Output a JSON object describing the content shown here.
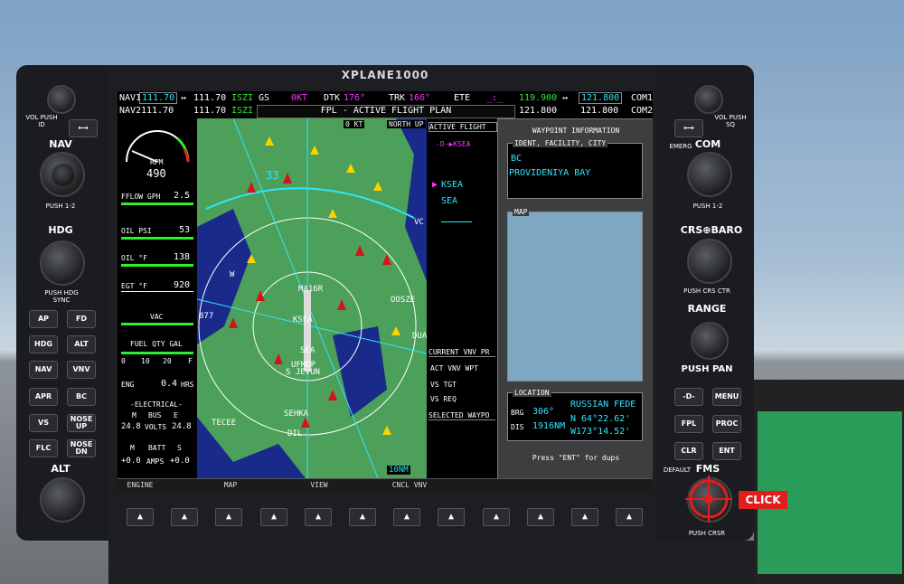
{
  "title": "XPLANE1000",
  "nav1": {
    "label": "NAV1",
    "active": "111.70",
    "standby": "111.70",
    "ident": "ISZI"
  },
  "nav2": {
    "label": "NAV2",
    "active": "111.70",
    "standby": "111.70",
    "ident": "ISZI"
  },
  "top": {
    "gs_label": "GS",
    "gs_val": "0KT",
    "dtk_label": "DTK",
    "dtk_val": "176°",
    "trk_label": "TRK",
    "trk_val": "166°",
    "ete_label": "ETE",
    "ete_val": "_:_",
    "fpl_banner": "FPL - ACTIVE FLIGHT PLAN"
  },
  "com1": {
    "label": "COM1",
    "active": "119.900",
    "standby": "121.800"
  },
  "com2": {
    "label": "COM2",
    "active": "121.800",
    "standby": "121.800"
  },
  "eis": {
    "rpm_label": "RPM",
    "rpm_val": "490",
    "fflow_label": "FFLOW GPH",
    "fflow_val": "2.5",
    "oilpsi_label": "OIL PSI",
    "oilpsi_val": "53",
    "oilf_label": "OIL °F",
    "oilf_val": "138",
    "egt_label": "EGT °F",
    "egt_val": "920",
    "vac_label": "VAC",
    "fuel_label": "FUEL QTY GAL",
    "fuel_ticks": [
      "0",
      "10",
      "20"
    ],
    "fuel_f": "F",
    "eng_label": "ENG",
    "eng_val": "0.4",
    "eng_unit": "HRS",
    "elec_label": "-ELECTRICAL-",
    "bus_m": "M",
    "bus_label": "BUS",
    "bus_e": "E",
    "volts_m": "24.8",
    "volts_unit": "VOLTS",
    "volts_e": "24.8",
    "batt_m": "M",
    "batt_label": "BATT",
    "batt_s": "S",
    "amps_m": "+0.0",
    "amps_unit": "AMPS",
    "amps_s": "+0.0"
  },
  "map": {
    "speed": "0 KT",
    "orient": "NORTH UP",
    "range": "10NM",
    "labels": [
      "MA16R",
      "KSEA",
      "SEA",
      "UFMDP",
      "S JEVUN",
      "TECEE",
      "OOSZE",
      "877",
      "DUA",
      "W",
      "VC",
      "33",
      "SEHKA",
      "DIL"
    ]
  },
  "fpl": {
    "header": "ACTIVE FLIGHT",
    "leg": "-D-▶KSEA",
    "items": [
      "KSEA",
      "SEA"
    ],
    "vnv_header": "CURRENT VNV PR",
    "vnv_rows": [
      "ACT VNV WPT",
      "VS TGT",
      "VS REQ"
    ],
    "sel_header": "SELECTED WAYPO"
  },
  "wpt": {
    "title": "WAYPOINT INFORMATION",
    "ident_header": "IDENT, FACILITY, CITY",
    "ident_val": "BC",
    "facility": "PROVIDENIYA BAY",
    "map_header": "MAP",
    "loc_header": "LOCATION",
    "brg_label": "BRG",
    "brg_val": "306°",
    "country": "RUSSIAN FEDE",
    "dis_label": "DIS",
    "dis_val": "1916NM",
    "lat": "N 64°22.62'",
    "lon": "W173°14.52'",
    "footer": "Press \"ENT\" for dups"
  },
  "softkeys": [
    "ENGINE",
    "MAP",
    "VIEW",
    "CNCL VNV"
  ],
  "left": {
    "vol_push_id": "VOL PUSH ID",
    "nav": "NAV",
    "push_12": "PUSH 1-2",
    "hdg": "HDG",
    "push_hdg_sync": "PUSH HDG SYNC",
    "buttons": [
      [
        "AP",
        "FD"
      ],
      [
        "HDG",
        "ALT"
      ],
      [
        "NAV",
        "VNV"
      ],
      [
        "APR",
        "BC"
      ],
      [
        "VS",
        "NOSE UP"
      ],
      [
        "FLC",
        "NOSE DN"
      ]
    ],
    "alt": "ALT"
  },
  "right": {
    "vol_push_sq": "VOL PUSH SQ",
    "emerg": "EMERG",
    "com": "COM",
    "push_12": "PUSH 1-2",
    "crs_baro": "CRS⊕BARO",
    "push_crs_ctr": "PUSH CRS CTR",
    "range": "RANGE",
    "pan": "PUSH PAN",
    "buttons": [
      [
        "-D-",
        "MENU"
      ],
      [
        "FPL",
        "PROC"
      ],
      [
        "CLR",
        "ENT"
      ]
    ],
    "default": "DEFAULT",
    "fms": "FMS",
    "push_crsr": "PUSH CRSR"
  },
  "click_label": "CLICK"
}
